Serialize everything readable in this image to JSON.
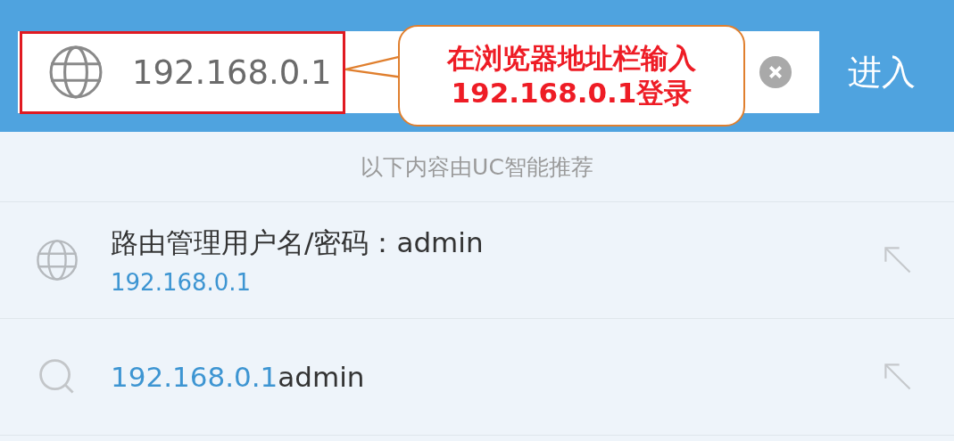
{
  "address_bar": {
    "value": "192.168.0.1",
    "highlighted": true
  },
  "callout": {
    "lines": [
      "在浏览器地址栏输入",
      "192.168.0.1登录"
    ]
  },
  "enter_button": "进入",
  "hint": "以下内容由UC智能推荐",
  "suggestions": [
    {
      "kind": "site",
      "title": "路由管理用户名/密码：admin",
      "url": "192.168.0.1"
    },
    {
      "kind": "search",
      "match": "192.168.0.1",
      "rest": "admin"
    }
  ]
}
